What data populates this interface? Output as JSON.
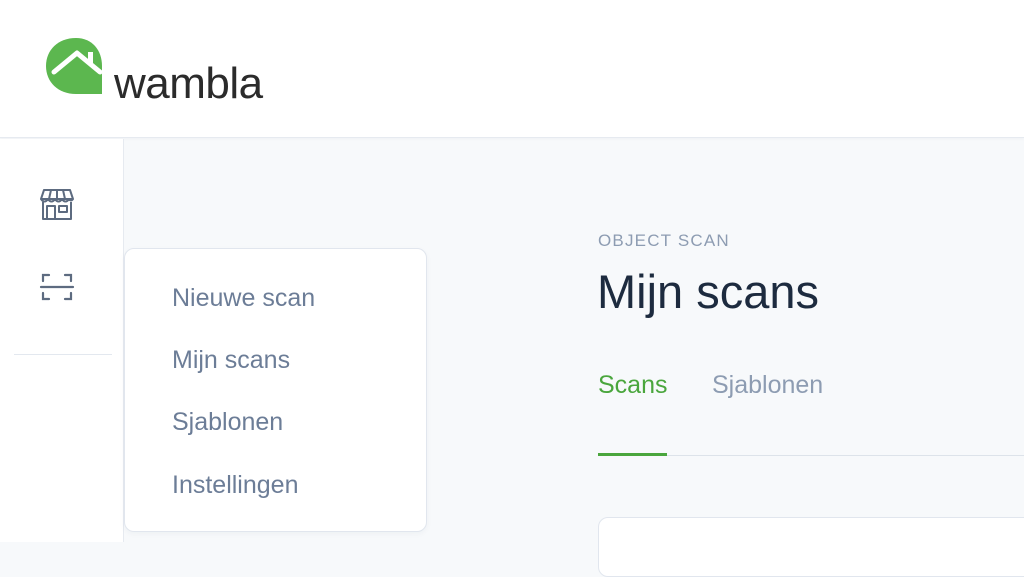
{
  "header": {
    "logo": {
      "text": "wambla",
      "icon": "house-speech-bubble-logo",
      "color": "#5cb74f"
    }
  },
  "rail": {
    "items": [
      {
        "icon": "storefront-icon"
      },
      {
        "icon": "scan-frame-icon"
      }
    ]
  },
  "menu": {
    "items": [
      {
        "label": "Nieuwe scan"
      },
      {
        "label": "Mijn scans"
      },
      {
        "label": "Sjablonen"
      },
      {
        "label": "Instellingen"
      }
    ]
  },
  "main": {
    "overline": "OBJECT SCAN",
    "title": "Mijn scans",
    "tabs": [
      {
        "label": "Scans",
        "active": true
      },
      {
        "label": "Sjablonen",
        "active": false
      }
    ]
  },
  "colors": {
    "accent": "#4aa63d",
    "title": "#1d2b3f",
    "muted": "#8d9cb2",
    "menu_text": "#6c7d97"
  }
}
